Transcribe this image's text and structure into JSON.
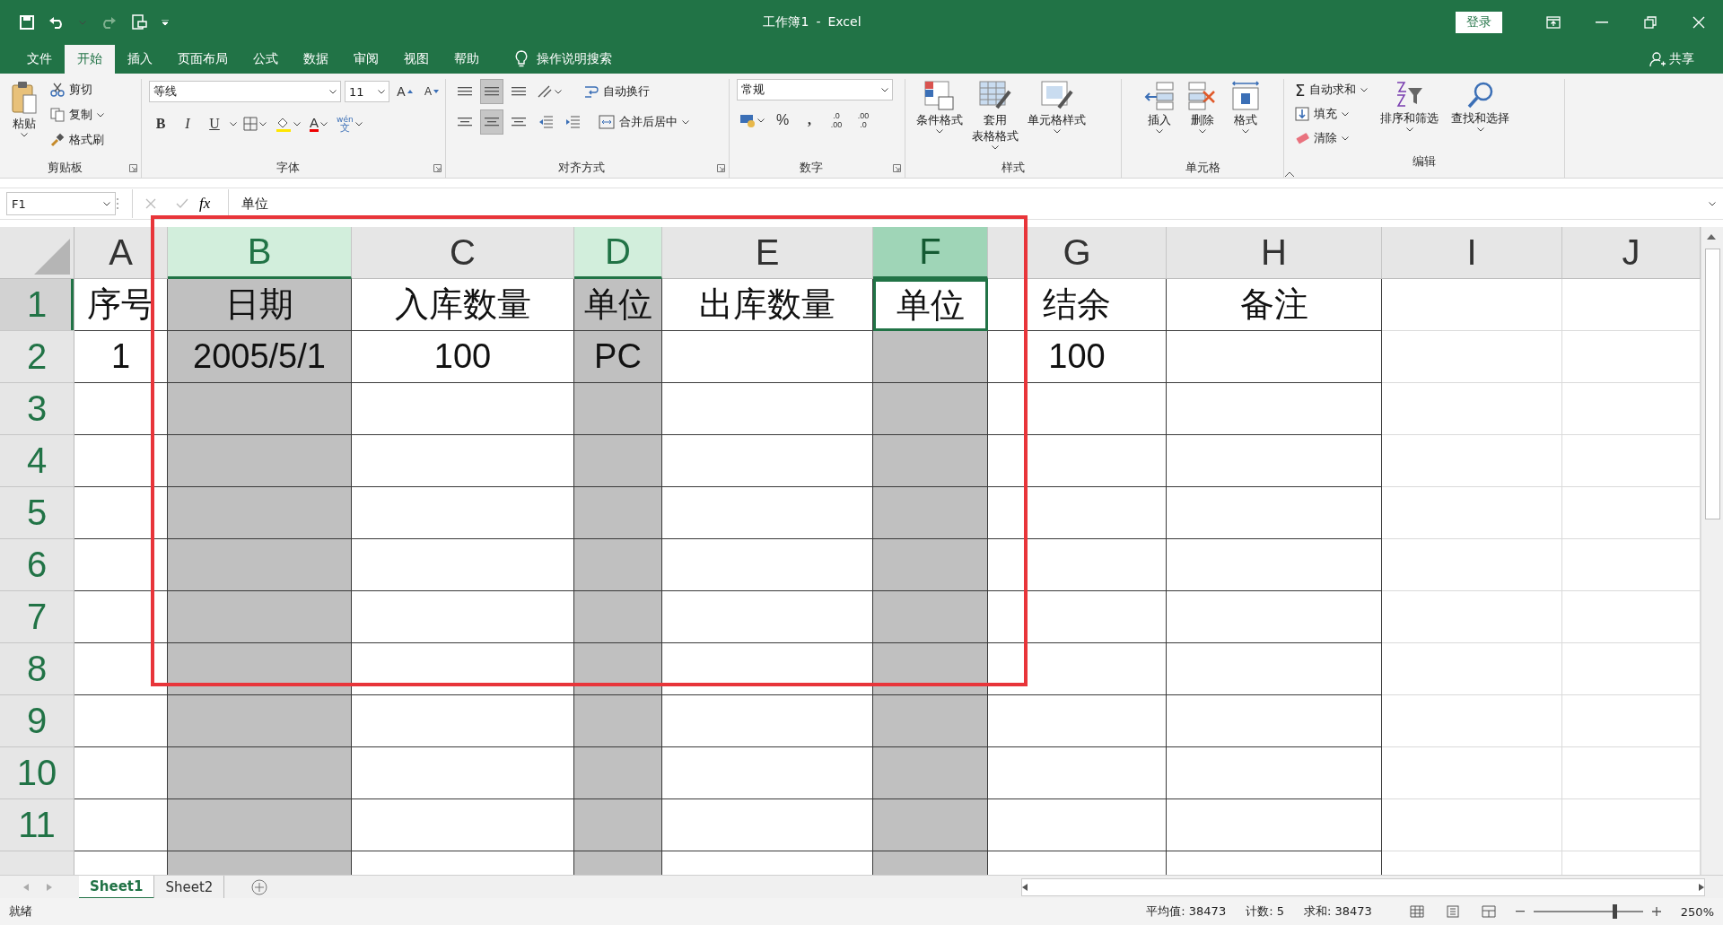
{
  "title_bar": {
    "document": "工作簿1",
    "separator": "-",
    "app": "Excel",
    "sign_in": "登录"
  },
  "menu_tabs": [
    {
      "label": "文件",
      "selected": false
    },
    {
      "label": "开始",
      "selected": true
    },
    {
      "label": "插入",
      "selected": false
    },
    {
      "label": "页面布局",
      "selected": false
    },
    {
      "label": "公式",
      "selected": false
    },
    {
      "label": "数据",
      "selected": false
    },
    {
      "label": "审阅",
      "selected": false
    },
    {
      "label": "视图",
      "selected": false
    },
    {
      "label": "帮助",
      "selected": false
    }
  ],
  "tell_me": "操作说明搜索",
  "share": "共享",
  "ribbon": {
    "clipboard": {
      "label": "剪贴板",
      "paste": "粘贴",
      "cut": "剪切",
      "copy": "复制",
      "format_painter": "格式刷"
    },
    "font": {
      "label": "字体",
      "font_name": "等线",
      "font_size": "11",
      "grow": "A",
      "shrink": "A",
      "bold": "B",
      "italic": "I",
      "underline": "U",
      "font_color": "A",
      "phonetic_top": "wén",
      "phonetic_bottom": "文"
    },
    "alignment": {
      "label": "对齐方式",
      "vertical_align": [
        {
          "selected": false
        },
        {
          "selected": true
        },
        {
          "selected": false
        }
      ],
      "horizontal_align": [
        {
          "selected": false
        },
        {
          "selected": true
        },
        {
          "selected": false
        }
      ],
      "wrap": "自动换行",
      "merge": "合并后居中"
    },
    "number": {
      "label": "数字",
      "format": "常规",
      "percent": "%",
      "comma": ",",
      "increase_top": ".0",
      "increase_bottom": ".00",
      "decrease_top": ".00",
      "decrease_bottom": ".0"
    },
    "styles": {
      "label": "样式",
      "items": [
        {
          "kind": "conditional",
          "lines": [
            "条件格式"
          ]
        },
        {
          "kind": "table",
          "lines": [
            "套用",
            "表格格式"
          ]
        },
        {
          "kind": "cellstyle",
          "lines": [
            "单元格样式"
          ]
        }
      ]
    },
    "cells": {
      "label": "单元格",
      "items": [
        {
          "kind": "insert",
          "label": "插入"
        },
        {
          "kind": "delete",
          "label": "删除"
        },
        {
          "kind": "format",
          "label": "格式"
        }
      ]
    },
    "editing": {
      "label": "编辑",
      "autosum_sign": "Σ",
      "autosum": "自动求和",
      "fill": "填充",
      "clear": "清除",
      "sort": "排序和筛选",
      "find": "查找和选择"
    }
  },
  "formula_bar": {
    "name_box": "F1",
    "fx": "fx",
    "content": "单位"
  },
  "sheet": {
    "columns": [
      {
        "label": "A",
        "selected": false,
        "active": false,
        "shaded": false,
        "bordered": true
      },
      {
        "label": "B",
        "selected": true,
        "active": false,
        "shaded": true,
        "bordered": true
      },
      {
        "label": "C",
        "selected": false,
        "active": false,
        "shaded": false,
        "bordered": true
      },
      {
        "label": "D",
        "selected": true,
        "active": false,
        "shaded": true,
        "bordered": true
      },
      {
        "label": "E",
        "selected": false,
        "active": false,
        "shaded": false,
        "bordered": true
      },
      {
        "label": "F",
        "selected": true,
        "active": true,
        "shaded": true,
        "bordered": true
      },
      {
        "label": "G",
        "selected": false,
        "active": false,
        "shaded": false,
        "bordered": true
      },
      {
        "label": "H",
        "selected": false,
        "active": false,
        "shaded": false,
        "bordered": true
      },
      {
        "label": "I",
        "selected": false,
        "active": false,
        "shaded": false,
        "bordered": false
      },
      {
        "label": "J",
        "selected": false,
        "active": false,
        "shaded": false,
        "bordered": false
      }
    ],
    "rows": [
      {
        "label": "1",
        "active": true,
        "cells": [
          "序号",
          "日期",
          "入库数量",
          "单位",
          "出库数量",
          "单位",
          "结余",
          "备注"
        ]
      },
      {
        "label": "2",
        "active": false,
        "cells": [
          "1",
          "2005/5/1",
          "100",
          "PC",
          null,
          null,
          "100",
          null
        ]
      },
      {
        "label": "3",
        "active": false
      },
      {
        "label": "4",
        "active": false
      },
      {
        "label": "5",
        "active": false
      },
      {
        "label": "6",
        "active": false
      },
      {
        "label": "7",
        "active": false
      },
      {
        "label": "8",
        "active": false
      },
      {
        "label": "9",
        "active": false
      },
      {
        "label": "10",
        "active": false
      },
      {
        "label": "11",
        "active": false
      }
    ]
  },
  "sheet_tabs": [
    {
      "label": "Sheet1",
      "selected": true
    },
    {
      "label": "Sheet2",
      "selected": false
    }
  ],
  "status_bar": {
    "mode": "就绪",
    "average": "平均值: 38473",
    "count": "计数: 5",
    "sum": "求和: 38473",
    "zoom": "250%",
    "zoom_slider": {
      "level": 0.75
    }
  }
}
